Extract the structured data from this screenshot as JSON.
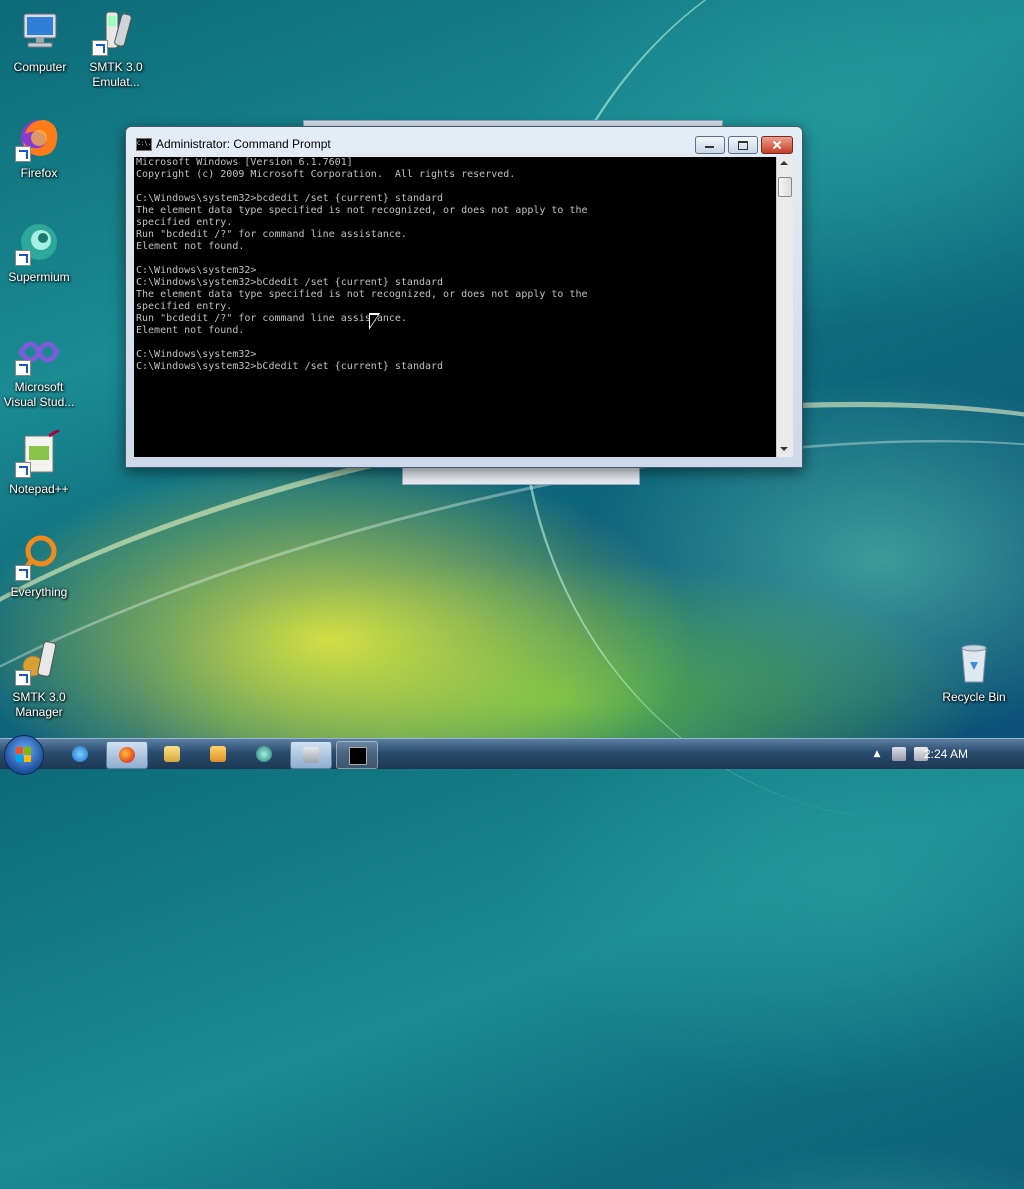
{
  "desktop": {
    "icons": [
      {
        "label": "Computer"
      },
      {
        "label": "SMTK 3.0\nEmulat..."
      },
      {
        "label": "Firefox"
      },
      {
        "label": "Supermium"
      },
      {
        "label": "Microsoft\nVisual Stud..."
      },
      {
        "label": "Notepad++"
      },
      {
        "label": "Everything"
      },
      {
        "label": "SMTK 3.0\nManager"
      },
      {
        "label": "Recycle Bin"
      }
    ]
  },
  "cmd_window": {
    "title": "Administrator: Command Prompt",
    "title_icon": "C:\\.",
    "lines": [
      "Microsoft Windows [Version 6.1.7601]",
      "Copyright (c) 2009 Microsoft Corporation.  All rights reserved.",
      "",
      "C:\\Windows\\system32>bcdedit /set {current} standard",
      "The element data type specified is not recognized, or does not apply to the",
      "specified entry.",
      "Run \"bcdedit /?\" for command line assistance.",
      "Element not found.",
      "",
      "C:\\Windows\\system32>",
      "C:\\Windows\\system32>bCdedit /set {current} standard",
      "The element data type specified is not recognized, or does not apply to the",
      "specified entry.",
      "Run \"bcdedit /?\" for command line assistance.",
      "Element not found.",
      "",
      "C:\\Windows\\system32>",
      "C:\\Windows\\system32>bCdedit /set {current} standard"
    ]
  },
  "taskbar": {
    "clock": "2:24 AM",
    "items": [
      "internet-explorer-icon",
      "firefox-icon",
      "explorer-icon",
      "media-player-icon",
      "supermium-icon",
      "smtk-icon",
      "command-prompt-icon"
    ]
  }
}
